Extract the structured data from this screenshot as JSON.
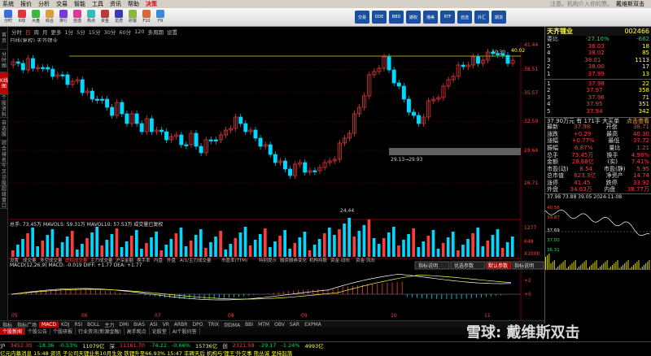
{
  "menubar": {
    "items": [
      "系统",
      "报价",
      "分析",
      "交易",
      "智能",
      "工具",
      "资讯",
      "帮助"
    ],
    "brand": "决策",
    "tip": "注意。机构介入你的票。",
    "right_tip": "戴维斯双击"
  },
  "toolbar": {
    "buttons": [
      "分时",
      "K线",
      "大盘",
      "综合",
      "排行",
      "自选",
      "热点",
      "资金",
      "龙虎",
      "研报",
      "F10",
      "F9"
    ],
    "right_buttons": [
      "交易",
      "DDE",
      "BBD",
      "期权",
      "港美",
      "RTF",
      "自选",
      "外汇",
      "期货"
    ]
  },
  "leftnav": [
    "首页",
    "分时图",
    "K线图",
    "个股资料",
    "自选股",
    "综合排名",
    "牛叉诊股",
    "超级盘口"
  ],
  "periodbar": {
    "items": [
      "分时",
      "日",
      "周",
      "月",
      "更多",
      "1分",
      "5分",
      "15分",
      "30分",
      "60分",
      "120",
      "多周期",
      "设置"
    ],
    "selected": "日"
  },
  "chart": {
    "title": "日线(复权)  天齐锂业",
    "price_axis": [
      "41.44",
      "38.51",
      "35.57",
      "32.59",
      "29.64",
      "26.71"
    ],
    "label_high": "40.30",
    "label_top": "40.02",
    "label_mid": "29.13→29.93",
    "label_low": "24.44",
    "hline_label": "29.64",
    "x_labels": [
      "05",
      "06",
      "07",
      "08",
      "09",
      "10",
      "11"
    ],
    "vol_title": "总手: 73.45万  MAVOL5: 59.31万  MAVOL10: 57.53万  成交量已复权",
    "vol_axis": [
      "1277",
      "649",
      "X1000"
    ],
    "vol_tabs": [
      "设置",
      "成交量",
      "多空成交量",
      "虚拟成交量",
      "主力成交量",
      "沪深金额",
      "换手率",
      "内盘",
      "外盘",
      "A/1/主力成交量",
      "市盈率(TTM)",
      "特别提示",
      "融资融券变化",
      "机构持股",
      "资金·动向",
      "资金·流向"
    ],
    "macd_title": "MACD(12,26,9)  MACD: -0.019  DIFF: +1.77  DEA: +1.77",
    "macd_buttons": [
      "指标说明",
      "优选参数",
      "默认参数",
      "指标说明"
    ],
    "macd_axis": [
      "+2",
      "+0"
    ]
  },
  "indicator_tabs": [
    "指标",
    "指标广场",
    "MACD",
    "KDJ",
    "RSI",
    "BOLL",
    "主力",
    "DMI",
    "BIAS",
    "ASI",
    "VR",
    "ARBR",
    "DPO",
    "TRIX",
    "剑DMA",
    "BBI",
    "MTM",
    "OBV",
    "SAR",
    "EXPMA"
  ],
  "indicator_selected": "MACD",
  "bottom_tabs": [
    "个股新闻",
    "个股公告",
    "个股研报",
    "行业资讯(新源金融)",
    "高手观点",
    "论股堂",
    "AI个股问答"
  ],
  "bottom_selected": "个股新闻",
  "quote": {
    "name": "天齐锂业",
    "code": "002466",
    "webi_label": "委比",
    "webi": "-27.10%",
    "webi_diff": "-662",
    "sell": [
      [
        "5",
        "38.03",
        "18"
      ],
      [
        "4",
        "38.02",
        "85"
      ],
      [
        "3",
        "38.01",
        "1113"
      ],
      [
        "2",
        "38.00",
        "17"
      ],
      [
        "1",
        "37.99",
        "13"
      ]
    ],
    "buy": [
      [
        "1",
        "37.98",
        "22"
      ],
      [
        "2",
        "37.97",
        "358"
      ],
      [
        "3",
        "37.96",
        "71"
      ],
      [
        "4",
        "37.95",
        "351"
      ],
      [
        "5",
        "37.94",
        "342"
      ]
    ],
    "summary": "37.90万元 有 171手 大买单",
    "summary_link": "点击查看",
    "stats": [
      [
        "最新",
        "37.98",
        "开盘",
        "38.71"
      ],
      [
        "涨跌",
        "+0.29",
        "最高",
        "40.30"
      ],
      [
        "涨幅",
        "+0.77%",
        "最低",
        "37.72"
      ],
      [
        "振幅",
        "6.87%",
        "量比",
        "1.21"
      ],
      [
        "总手",
        "73.45万",
        "换手",
        "4.98%"
      ],
      [
        "金额",
        "28.68亿",
        "(实)",
        "7.41%"
      ],
      [
        "市盈(动)",
        "8.54",
        "市盈(静)",
        "5.95"
      ],
      [
        "总市值",
        "623.3亿",
        "净资产",
        "14.74"
      ],
      [
        "涨停",
        "41.45",
        "跌停",
        "33.92"
      ],
      [
        "外盘",
        "34.63万",
        "内盘",
        "38.77万"
      ]
    ],
    "mini_header": "37.98  73.88  39.05  2024-11-08",
    "mini_axis": [
      "40.56",
      "39.87",
      "37.69",
      "37.00",
      "36.31"
    ]
  },
  "ticker": [
    {
      "t": "沪",
      "c": "wht"
    },
    {
      "t": "3452.30",
      "c": "red"
    },
    {
      "t": "-18.36",
      "c": "grn"
    },
    {
      "t": "-0.53%",
      "c": "grn"
    },
    {
      "t": "11079亿",
      "c": "yel"
    },
    {
      "t": "深",
      "c": "wht"
    },
    {
      "t": "11161.70",
      "c": "red"
    },
    {
      "t": "-74.22",
      "c": "grn"
    },
    {
      "t": "-0.66%",
      "c": "grn"
    },
    {
      "t": "15736亿",
      "c": "yel"
    },
    {
      "t": "创",
      "c": "wht"
    },
    {
      "t": "2321.59",
      "c": "red"
    },
    {
      "t": "-29.17",
      "c": "grn"
    },
    {
      "t": "-1.24%",
      "c": "grn"
    },
    {
      "t": "4993亿",
      "c": "yel"
    }
  ],
  "news": "亿元内幕消息  15:48 资讯  子公司天锂业务10月生效 铁锂升至66.93%  15:47 丰碑天后  机构与'锂王'外交事  熊丛诚  坚持起落",
  "watermark": "雪球: 戴维斯双击"
}
